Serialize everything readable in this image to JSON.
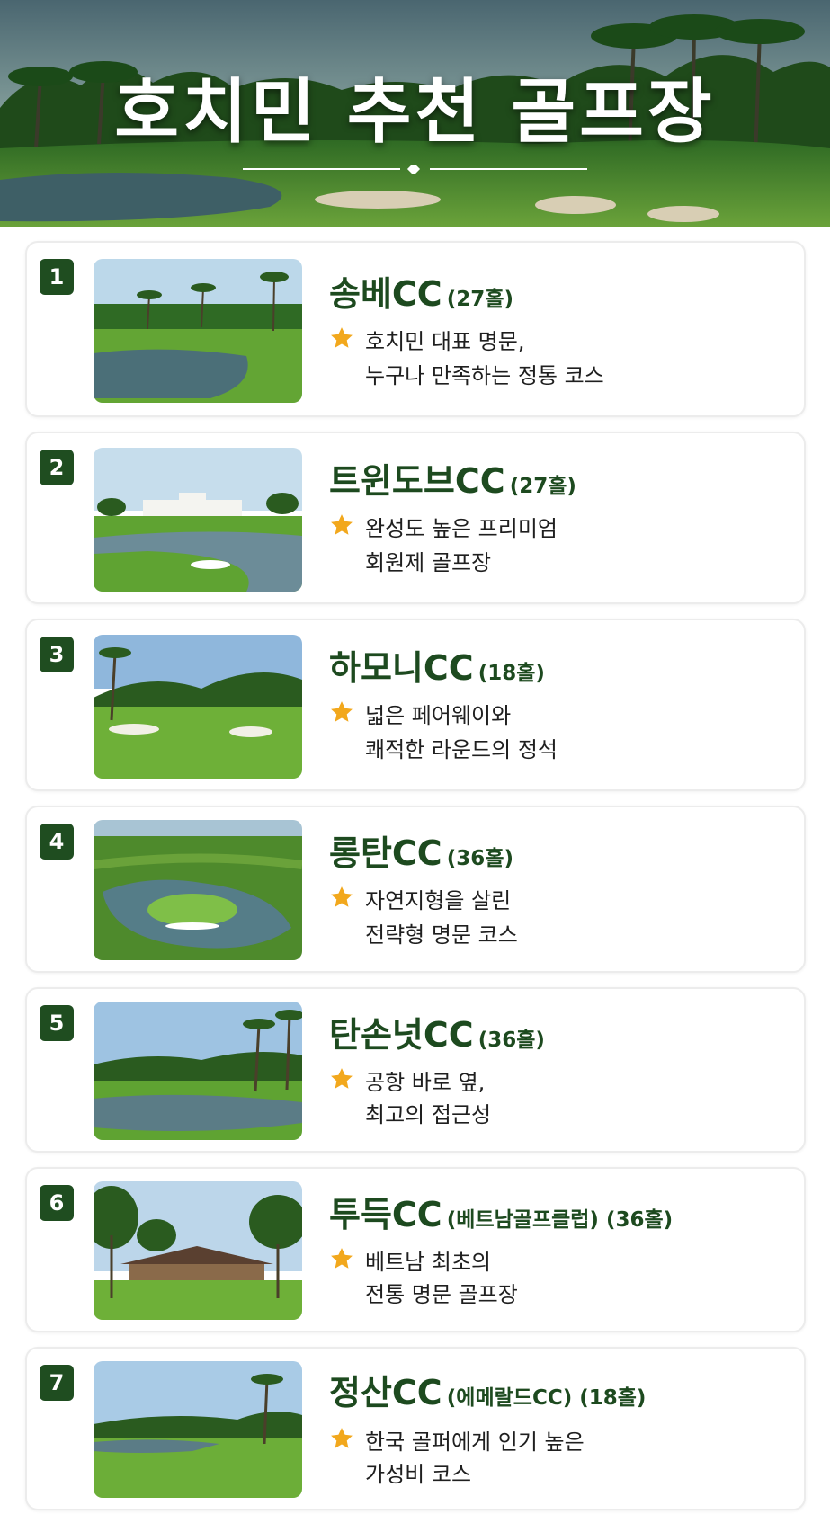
{
  "header": {
    "title": "호치민 추천 골프장"
  },
  "colors": {
    "badge": "#1f4d20",
    "title_green": "#1d4a1f",
    "star": "#f2a81d"
  },
  "courses": [
    {
      "rank": "1",
      "name": "송베CC",
      "suffix": "(27홀)",
      "desc1": "호치민 대표 명문,",
      "desc2": "누구나 만족하는 정통 코스",
      "icon": "star-icon"
    },
    {
      "rank": "2",
      "name": "트윈도브CC",
      "suffix": "(27홀)",
      "desc1": "완성도 높은 프리미엄",
      "desc2": "회원제 골프장",
      "icon": "star-icon"
    },
    {
      "rank": "3",
      "name": "하모니CC",
      "suffix": "(18홀)",
      "desc1": "넓은 페어웨이와",
      "desc2": "쾌적한 라운드의 정석",
      "icon": "star-icon"
    },
    {
      "rank": "4",
      "name": "롱탄CC",
      "suffix": "(36홀)",
      "desc1": "자연지형을 살린",
      "desc2": "전략형 명문 코스",
      "icon": "star-icon"
    },
    {
      "rank": "5",
      "name": "탄손넛CC",
      "suffix": "(36홀)",
      "desc1": "공항 바로 옆,",
      "desc2": "최고의 접근성",
      "icon": "star-icon"
    },
    {
      "rank": "6",
      "name": "투득CC",
      "suffix": "(베트남골프클럽) (36홀)",
      "desc1": "베트남 최초의",
      "desc2": "전통 명문 골프장",
      "icon": "star-icon"
    },
    {
      "rank": "7",
      "name": "정산CC",
      "suffix": "(에메랄드CC) (18홀)",
      "desc1": "한국 골퍼에게 인기 높은",
      "desc2": "가성비 코스",
      "icon": "star-icon"
    }
  ]
}
